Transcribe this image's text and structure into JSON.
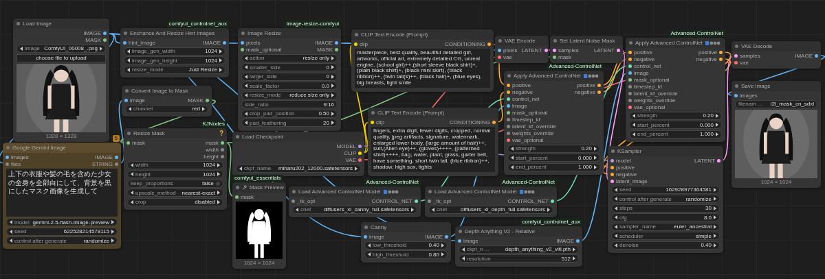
{
  "nodes": [
    {
      "title": "Load Image",
      "outputs": [
        {
          "name": "IMAGE",
          "color": "#64b5f6"
        },
        {
          "name": "MASK",
          "color": "#81c784"
        }
      ],
      "widgets": [
        {
          "kind": "combo",
          "label": "image",
          "value": "ComfyUI_00008_.png"
        },
        {
          "kind": "button",
          "label": "choose file to upload"
        }
      ],
      "preview": {
        "kind": "picture",
        "caption": "1328 × 1328"
      }
    },
    {
      "title": "Google Gemini Image",
      "badge": "5",
      "color": "#4f4128",
      "inputs": [
        {
          "name": "images",
          "color": "#64b5f6"
        },
        {
          "name": "files",
          "color": "#888888"
        }
      ],
      "outputs": [
        {
          "name": "IMAGE",
          "color": "#64b5f6"
        },
        {
          "name": "STRING",
          "color": "#888888"
        }
      ],
      "textarea": {
        "kind": "plain",
        "text": "上下の衣服や髪の毛を含めた少女の全身を全部白にして、背景を黒にしたマスク画像を生成して"
      },
      "widgets": [
        {
          "kind": "combo",
          "label": "model",
          "value": "gemini-2.5-flash-image-preview"
        },
        {
          "kind": "number",
          "label": "seed",
          "value": "622528214578115"
        },
        {
          "kind": "combo",
          "label": "control after generate",
          "value": "randomize"
        }
      ]
    },
    {
      "title": "Enchance And Resize Hint Images",
      "tag": "comfyui_controlnet_aux",
      "inputs": [
        {
          "name": "hint_image",
          "color": "#64b5f6"
        }
      ],
      "outputs": [
        {
          "name": "IMAGE",
          "color": "#64b5f6"
        }
      ],
      "widgets": [
        {
          "kind": "number",
          "label": "image_gen_width",
          "value": "1024"
        },
        {
          "kind": "number",
          "label": "image_gen_height",
          "value": "1024"
        },
        {
          "kind": "combo",
          "label": "resize_mode",
          "value": "Just Resize"
        }
      ]
    },
    {
      "title": "Convert Image to Mask",
      "inputs": [
        {
          "name": "image",
          "color": "#64b5f6"
        }
      ],
      "outputs": [
        {
          "name": "MASK",
          "color": "#81c784"
        }
      ],
      "widgets": [
        {
          "kind": "combo",
          "label": "channel",
          "value": "red"
        }
      ]
    },
    {
      "title": "Resize Mask",
      "tag": "KJNodes",
      "help": "?",
      "inputs": [
        {
          "name": "mask",
          "color": "#81c784"
        }
      ],
      "outputs": [
        {
          "name": "mask",
          "color": "#81c784"
        },
        {
          "name": "width",
          "color": "#888888"
        },
        {
          "name": "height",
          "color": "#888888"
        }
      ],
      "widgets": [
        {
          "kind": "number",
          "label": "width",
          "value": "1024"
        },
        {
          "kind": "number",
          "label": "height",
          "value": "1024"
        },
        {
          "kind": "toggle",
          "label": "keep_proportions",
          "value": "false",
          "on": false
        },
        {
          "kind": "combo",
          "label": "upscale_method",
          "value": "nearest-exact"
        },
        {
          "kind": "combo",
          "label": "crop",
          "value": "disabled"
        }
      ]
    },
    {
      "title": "Image Resize",
      "tag": "image-resize-comfyui",
      "inputs": [
        {
          "name": "pixels",
          "color": "#64b5f6"
        },
        {
          "name": "mask_optional",
          "color": "#81c784"
        }
      ],
      "outputs": [
        {
          "name": "IMAGE",
          "color": "#64b5f6"
        },
        {
          "name": "MASK",
          "color": "#81c784"
        }
      ],
      "widgets": [
        {
          "kind": "combo",
          "label": "action",
          "value": "resize only"
        },
        {
          "kind": "number",
          "label": "smaller_side",
          "value": "0"
        },
        {
          "kind": "number",
          "label": "larger_side",
          "value": "0"
        },
        {
          "kind": "number",
          "label": "scale_factor",
          "value": "0.0"
        },
        {
          "kind": "combo",
          "label": "resize_mode",
          "value": "reduce size only"
        },
        {
          "kind": "text",
          "label": "side_ratio",
          "value": "9:16"
        },
        {
          "kind": "number",
          "label": "crop_pad_position",
          "value": "0.50"
        },
        {
          "kind": "number",
          "label": "pad_feathering",
          "value": "20"
        }
      ]
    },
    {
      "title": "Load Checkpoint",
      "outputs": [
        {
          "name": "MODEL",
          "color": "#b39ddb"
        },
        {
          "name": "CLIP",
          "color": "#ffd500"
        },
        {
          "name": "VAE",
          "color": "#ff6e6e"
        }
      ],
      "widgets": [
        {
          "kind": "combo",
          "label": "ckpt_name",
          "value": "miharu202_12000.safetensors"
        }
      ]
    },
    {
      "title": "Mask Preview",
      "tag": "comfyui_essentials",
      "inputs": [
        {
          "name": "mask",
          "color": "#81c784"
        }
      ],
      "preview": {
        "kind": "picture",
        "caption": "1024 × 1024"
      }
    },
    {
      "title": "CLIP Text Encode (Prompt)",
      "inputs": [
        {
          "name": "clip",
          "color": "#ffd500"
        }
      ],
      "outputs": [
        {
          "name": "CONDITIONING",
          "color": "#ffa931"
        }
      ],
      "textarea": {
        "kind": "mono",
        "text": "masterpiece, best quality, beautiful detailed girl, artworks, official art, extremely detailed CG, unreal engine, (school girl)++,(short sleeve black shirt)+, (plain black shirt)+, (black mini skirt), (black ribbon)++, (twin tail(s)++, (black hair)+, (blue eyes), big breasts, light smile"
      }
    },
    {
      "title": "CLIP Text Encode (Prompt)",
      "inputs": [
        {
          "name": "clip",
          "color": "#ffd500"
        }
      ],
      "outputs": [
        {
          "name": "CONDITIONING",
          "color": "#ffa931"
        }
      ],
      "textarea": {
        "kind": "mono",
        "text": "fingers, extra digit, fewer digits, cropped, normal quality, jpeg artifacts, signature, watermark, enlarged lower body, (large amount of hair)++, suit,(Alien eye)++, (gloves)++++, (patterned shirt)++++, bag, water, plant, grass, garter belt, have something, short twin tail, (blue ribbon)++, shadow, high sox, tights"
      }
    },
    {
      "title": "Load Advanced ControlNet Model",
      "tag": "Advanced-ControlNet",
      "title_icons": true,
      "inputs": [
        {
          "name": "_tk_opt",
          "color": "#888888"
        }
      ],
      "outputs": [
        {
          "name": "CONTROL_NET",
          "color": "#6ee0b0"
        }
      ],
      "widgets": [
        {
          "kind": "combo",
          "label": "cnet",
          "value": "diffusers_xl_canny_full.safetensors"
        }
      ]
    },
    {
      "title": "Canny",
      "inputs": [
        {
          "name": "image",
          "color": "#64b5f6"
        }
      ],
      "outputs": [
        {
          "name": "IMAGE",
          "color": "#64b5f6"
        }
      ],
      "widgets": [
        {
          "kind": "number",
          "label": "low_threshold",
          "value": "0.40"
        },
        {
          "kind": "number",
          "label": "high_threshold",
          "value": "0.80"
        }
      ]
    },
    {
      "title": "VAE Encode",
      "inputs": [
        {
          "name": "pixels",
          "color": "#64b5f6"
        },
        {
          "name": "vae",
          "color": "#ff6e6e"
        }
      ],
      "outputs": [
        {
          "name": "LATENT",
          "color": "#ff9cf9"
        }
      ]
    },
    {
      "title": "Apply Advanced ControlNet",
      "tag": "Advanced-ControlNet",
      "title_icons": true,
      "inputs": [
        {
          "name": "positive",
          "color": "#ffa931"
        },
        {
          "name": "negative",
          "color": "#ffa931"
        },
        {
          "name": "control_net",
          "color": "#6ee0b0"
        },
        {
          "name": "image",
          "color": "#64b5f6"
        },
        {
          "name": "mask_optional",
          "color": "#81c784"
        },
        {
          "name": "timestep_kf",
          "color": "#888888"
        },
        {
          "name": "latent_kf_override",
          "color": "#888888"
        },
        {
          "name": "weights_override",
          "color": "#888888"
        },
        {
          "name": "vae_optional",
          "color": "#ff6e6e"
        }
      ],
      "outputs": [
        {
          "name": "positive",
          "color": "#ffa931"
        },
        {
          "name": "negative",
          "color": "#ffa931"
        }
      ],
      "widgets": [
        {
          "kind": "number",
          "label": "strength",
          "value": "0.20"
        },
        {
          "kind": "number",
          "label": "start_percent",
          "value": "0.000"
        },
        {
          "kind": "number",
          "label": "end_percent",
          "value": "1.000"
        }
      ]
    },
    {
      "title": "Load Advanced ControlNet Model",
      "tag": "Advanced-ControlNet",
      "title_icons": true,
      "inputs": [
        {
          "name": "_tk_opt",
          "color": "#888888"
        }
      ],
      "outputs": [
        {
          "name": "CONTROL_NET",
          "color": "#6ee0b0"
        }
      ],
      "widgets": [
        {
          "kind": "combo",
          "label": "cnet",
          "value": "diffusers_xl_depth_full.safetensors"
        }
      ]
    },
    {
      "title": "Depth Anything V2 - Relative",
      "tag": "comfyui_controlnet_aux",
      "inputs": [
        {
          "name": "image",
          "color": "#64b5f6"
        }
      ],
      "outputs": [
        {
          "name": "IMAGE",
          "color": "#64b5f6"
        }
      ],
      "widgets": [
        {
          "kind": "combo",
          "label": "ckpt_n ...",
          "value": "depth_anything_v2_vitl.pth"
        },
        {
          "kind": "number",
          "label": "resolution",
          "value": "512"
        }
      ]
    },
    {
      "title": "Set Latent Noise Mask",
      "inputs": [
        {
          "name": "samples",
          "color": "#ff9cf9"
        },
        {
          "name": "mask",
          "color": "#81c784"
        }
      ],
      "outputs": [
        {
          "name": "LATENT",
          "color": "#ff9cf9"
        }
      ]
    },
    {
      "title": "Apply Advanced ControlNet",
      "tag": "Advanced-ControlNet",
      "title_icons": true,
      "inputs": [
        {
          "name": "positive",
          "color": "#ffa931"
        },
        {
          "name": "negative",
          "color": "#ffa931"
        },
        {
          "name": "control_net",
          "color": "#6ee0b0"
        },
        {
          "name": "image",
          "color": "#64b5f6"
        },
        {
          "name": "mask_optional",
          "color": "#81c784"
        },
        {
          "name": "timestep_kf",
          "color": "#888888"
        },
        {
          "name": "latent_kf_override",
          "color": "#888888"
        },
        {
          "name": "weights_override",
          "color": "#888888"
        },
        {
          "name": "vae_optional",
          "color": "#ff6e6e"
        }
      ],
      "outputs": [
        {
          "name": "positive",
          "color": "#ffa931"
        },
        {
          "name": "negative",
          "color": "#ffa931"
        }
      ],
      "widgets": [
        {
          "kind": "number",
          "label": "strength",
          "value": "0.20"
        },
        {
          "kind": "number",
          "label": "start_percent",
          "value": "0.000"
        },
        {
          "kind": "number",
          "label": "end_percent",
          "value": "1.000"
        }
      ]
    },
    {
      "title": "KSampler",
      "inputs": [
        {
          "name": "model",
          "color": "#b39ddb"
        },
        {
          "name": "positive",
          "color": "#ffa931"
        },
        {
          "name": "negative",
          "color": "#ffa931"
        },
        {
          "name": "latent_image",
          "color": "#ff9cf9"
        }
      ],
      "outputs": [
        {
          "name": "LATENT",
          "color": "#ff9cf9"
        }
      ],
      "widgets": [
        {
          "kind": "number",
          "label": "seed",
          "value": "162928977364581"
        },
        {
          "kind": "combo",
          "label": "control after generate",
          "value": "randomize"
        },
        {
          "kind": "number",
          "label": "steps",
          "value": "30"
        },
        {
          "kind": "number",
          "label": "cfg",
          "value": "8.0"
        },
        {
          "kind": "combo",
          "label": "sampler_name",
          "value": "euler_ancestral"
        },
        {
          "kind": "combo",
          "label": "scheduler",
          "value": "simple"
        },
        {
          "kind": "number",
          "label": "denoise",
          "value": "0.40"
        }
      ]
    },
    {
      "title": "VAE Decode",
      "inputs": [
        {
          "name": "samples",
          "color": "#ff9cf9"
        },
        {
          "name": "vae",
          "color": "#ff6e6e"
        }
      ],
      "outputs": [
        {
          "name": "IMAGE",
          "color": "#64b5f6"
        }
      ]
    },
    {
      "title": "Save Image",
      "inputs": [
        {
          "name": "images",
          "color": "#64b5f6"
        }
      ],
      "widgets": [
        {
          "kind": "text",
          "label": "filenam ...",
          "value": "i2i_mask_cn_sdxl"
        }
      ],
      "preview": {
        "kind": "picture",
        "caption": "1024 × 1024"
      }
    }
  ]
}
